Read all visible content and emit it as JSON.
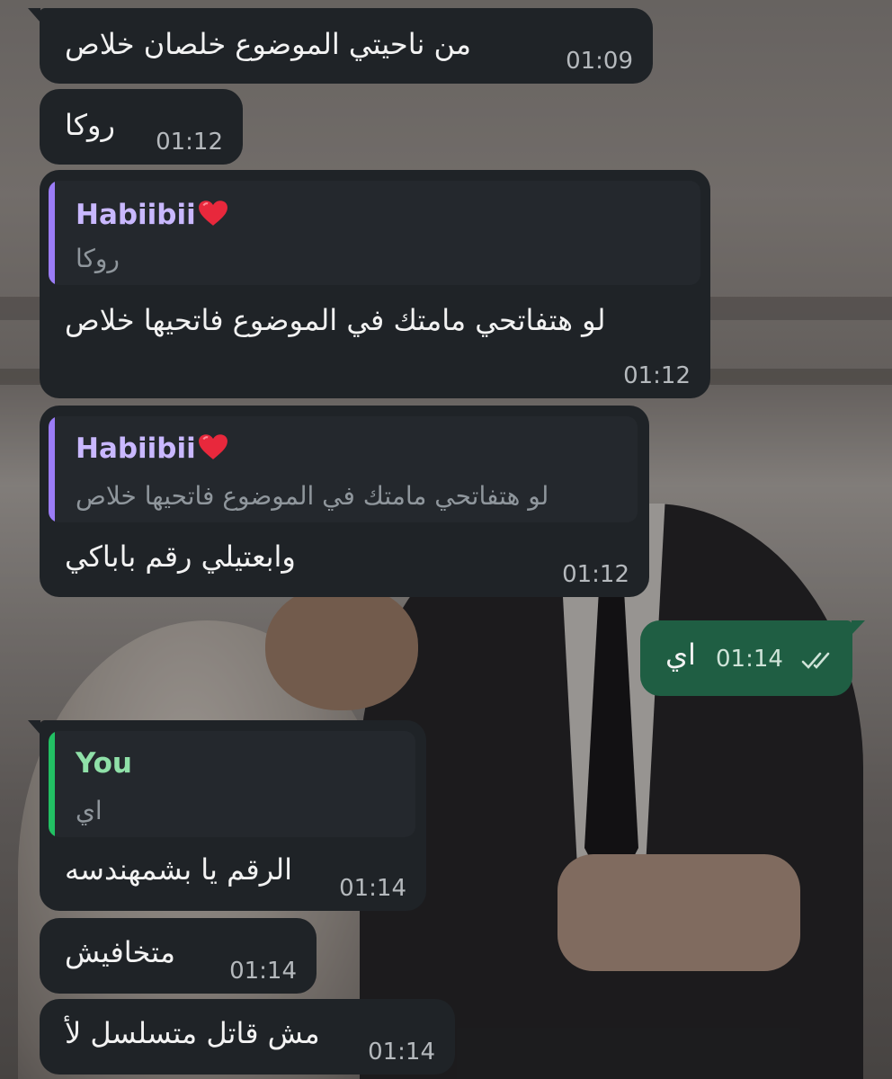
{
  "messages": [
    {
      "text": "من ناحيتي الموضوع خلصان خلاص",
      "time": "01:09"
    },
    {
      "text": "روكا",
      "time": "01:12"
    },
    {
      "reply_name": "Habiibii",
      "reply_text": "روكا",
      "text": "لو هتفاتحي مامتك في الموضوع فاتحيها خلاص",
      "time": "01:12"
    },
    {
      "reply_name": "Habiibii",
      "reply_text": "لو هتفاتحي مامتك في الموضوع فاتحيها خلاص",
      "text": "وابعتيلي رقم باباكي",
      "time": "01:12"
    },
    {
      "text": "اي",
      "time": "01:14"
    },
    {
      "reply_name": "You",
      "reply_text": "اي",
      "text": "الرقم يا بشمهندسه",
      "time": "01:14"
    },
    {
      "text": "متخافيش",
      "time": "01:14"
    },
    {
      "text": "مش قاتل متسلسل لأ",
      "time": "01:14"
    }
  ],
  "icons": {
    "heart": "red-heart-emoji",
    "read_receipt": "double-check-icon"
  },
  "colors": {
    "incoming_bubble": "#1f2327",
    "outgoing_bubble": "#1f5e43",
    "reply_accent_contact": "#9b7cf6",
    "reply_name_contact": "#c9b8ff",
    "reply_accent_self": "#22c063",
    "reply_name_self": "#8fe0a8"
  }
}
